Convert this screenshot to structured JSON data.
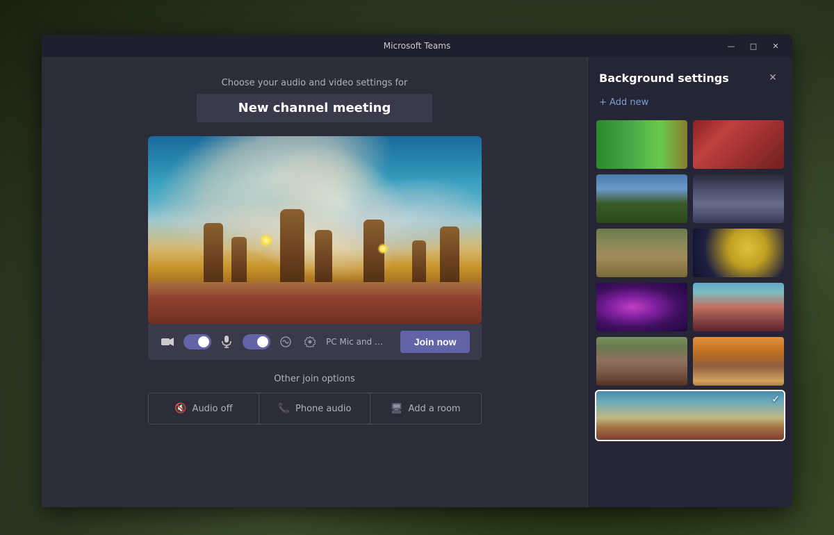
{
  "window": {
    "title": "Microsoft Teams",
    "controls": {
      "minimize": "—",
      "maximize": "□",
      "close": "✕"
    }
  },
  "main": {
    "subtitle": "Choose your audio and video settings for",
    "meeting_title": "New channel meeting",
    "video_toggle": true,
    "mic_toggle": true,
    "audio_device_label": "PC Mic and Sp...",
    "join_button_label": "Join now",
    "other_join_title": "Other join options",
    "join_options": [
      {
        "icon": "🔇",
        "label": "Audio off"
      },
      {
        "icon": "📞",
        "label": "Phone audio"
      },
      {
        "icon": "🖥",
        "label": "Add a room"
      }
    ]
  },
  "bg_panel": {
    "title": "Background settings",
    "close_icon": "✕",
    "add_new_label": "+ Add new",
    "thumbnails": [
      {
        "id": "green-bar",
        "style": "thumb-green-bar",
        "selected": false
      },
      {
        "id": "red-abstract",
        "style": "thumb-red-abstract",
        "selected": false
      },
      {
        "id": "mountain",
        "style": "thumb-mountain",
        "selected": false
      },
      {
        "id": "scifi-arch",
        "style": "thumb-scifi-arch",
        "selected": false
      },
      {
        "id": "ruins",
        "style": "thumb-ruins",
        "selected": false
      },
      {
        "id": "planet",
        "style": "thumb-planet",
        "selected": false
      },
      {
        "id": "galaxy",
        "style": "thumb-galaxy",
        "selected": false
      },
      {
        "id": "alien-landscape",
        "style": "thumb-alien-landscape",
        "selected": false
      },
      {
        "id": "cobblestone",
        "style": "thumb-cobblestone",
        "selected": false
      },
      {
        "id": "fantasy",
        "style": "thumb-fantasy",
        "selected": false
      },
      {
        "id": "desert-swirl",
        "style": "thumb-desert-swirl",
        "selected": true
      }
    ]
  }
}
